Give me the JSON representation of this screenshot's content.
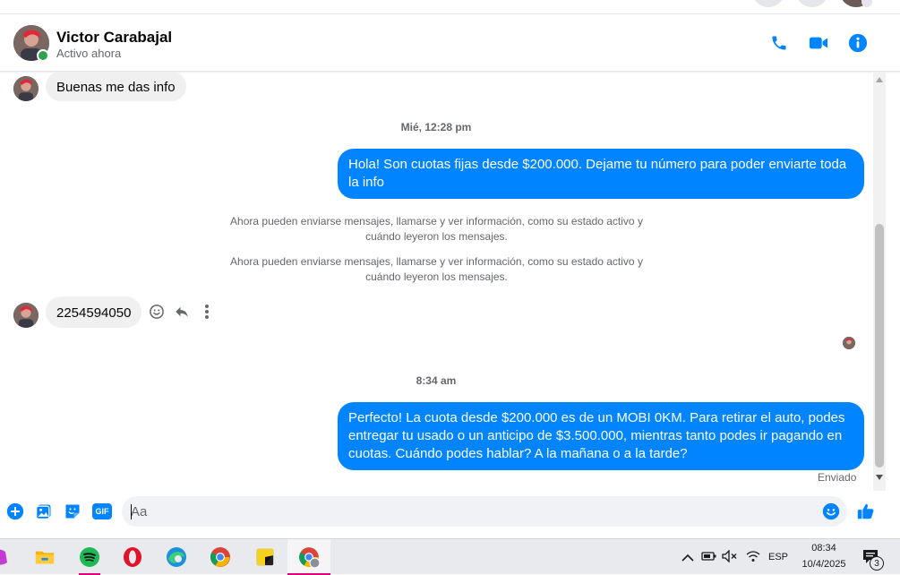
{
  "contact": {
    "name": "Victor Carabajal",
    "status": "Activo ahora"
  },
  "messages": {
    "incoming_1": "Buenas me das info",
    "timestamp_1": "Mié, 12:28 pm",
    "outgoing_1": "Hola! Son cuotas fijas desde $200.000. Dejame tu número para poder enviarte toda la info",
    "system_1": "Ahora pueden enviarse mensajes, llamarse y ver información, como su estado activo y cuándo leyeron los mensajes.",
    "system_2": "Ahora pueden enviarse mensajes, llamarse y ver información, como su estado activo y cuándo leyeron los mensajes.",
    "incoming_2": "2254594050",
    "timestamp_2": "8:34 am",
    "outgoing_2": "Perfecto! La cuota desde $200.000 es de un MOBI 0KM. Para retirar el auto, podes entregar tu usado o un anticipo de $3.500.000, mientras tanto podes ir pagando en cuotas. Cuándo podes hablar? A la mañana o a la tarde?",
    "sent_status": "Enviado"
  },
  "composer": {
    "placeholder": "Aa",
    "gif_label": "GIF"
  },
  "taskbar": {
    "language": "ESP",
    "time": "08:34",
    "date": "10/4/2025",
    "notification_count": "3"
  },
  "colors": {
    "accent": "#0084ff",
    "online": "#31a24c",
    "incoming_bubble": "#f0f0f0"
  }
}
